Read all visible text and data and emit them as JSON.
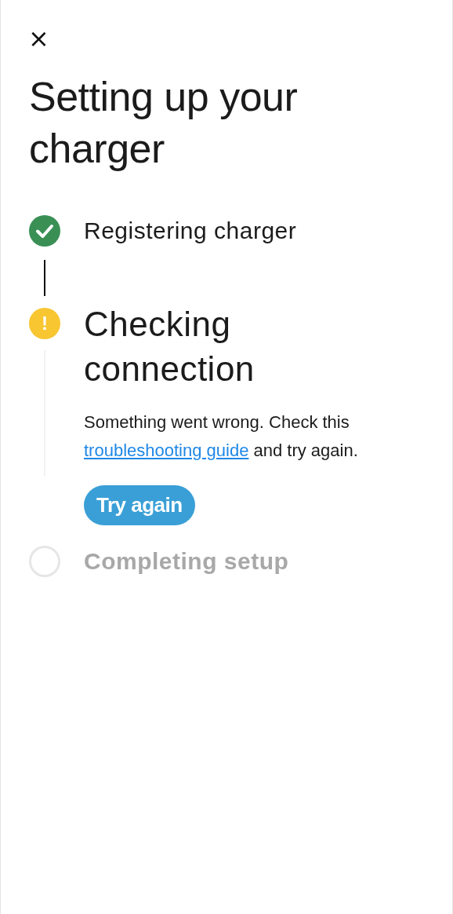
{
  "close": {
    "icon": "×"
  },
  "title": "Setting up your charger",
  "steps": [
    {
      "kind": "done",
      "label": "Registering charger"
    },
    {
      "kind": "warning",
      "label": "Checking connection",
      "icon": "!",
      "message": {
        "before": "Something went wrong. Check this",
        "link": " troubleshooting guide",
        "after": " and try again."
      },
      "button": "Try again"
    },
    {
      "kind": "pending",
      "label": "Completing setup"
    }
  ]
}
